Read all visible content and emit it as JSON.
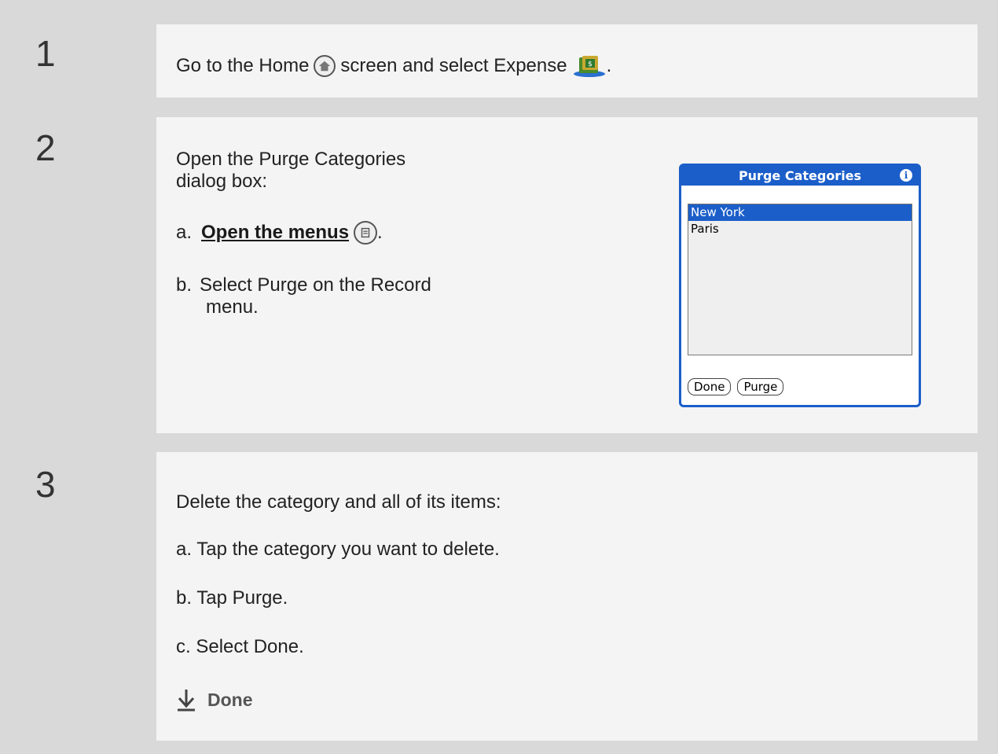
{
  "steps": [
    {
      "number": "1",
      "text_before": "Go to the Home",
      "home_icon": "home-icon",
      "text_middle": "screen and select Expense",
      "expense_icon": "expense-icon",
      "text_after": "."
    },
    {
      "number": "2",
      "intro_line1": "Open the Purge Categories",
      "intro_line2": "dialog box:",
      "sub_a_prefix": "a.",
      "sub_a_link": "Open the menus",
      "menu_icon": "menu-icon",
      "sub_a_suffix": ".",
      "sub_b_prefix": "b.",
      "sub_b_line1": "Select Purge on the Record",
      "sub_b_line2": "menu."
    },
    {
      "number": "3",
      "intro": "Delete the category and all of its items:",
      "sub_a": "a.  Tap the category you want to delete.",
      "sub_b": "b.  Tap Purge.",
      "sub_c": "c.  Select Done.",
      "done_label": "Done",
      "done_icon": "down-arrow-icon"
    }
  ],
  "dialog": {
    "title": "Purge Categories",
    "info": "i",
    "items": [
      "New York",
      "Paris"
    ],
    "selected_index": 0,
    "buttons": [
      "Done",
      "Purge"
    ]
  },
  "colors": {
    "accent": "#1b5ec9",
    "panel": "#f4f4f4",
    "background": "#d9d9d9"
  }
}
